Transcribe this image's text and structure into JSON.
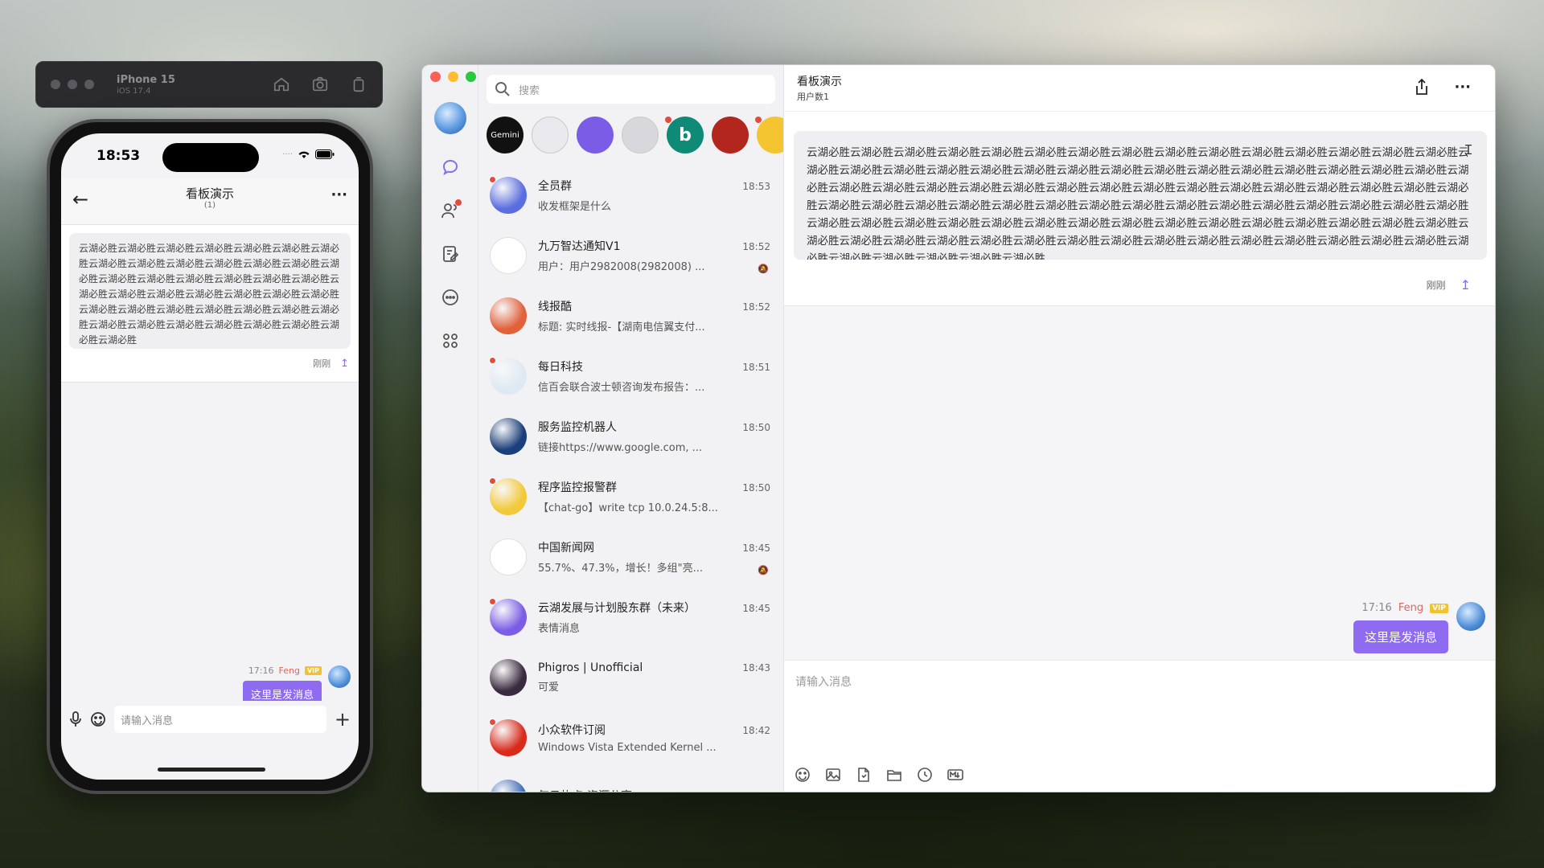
{
  "simulator": {
    "device": "iPhone 15",
    "os": "iOS 17.4",
    "icons": [
      "home-icon",
      "screenshot-icon",
      "rotate-icon"
    ]
  },
  "phone": {
    "time": "18:53",
    "title": "看板演示",
    "subtitle": "(1)",
    "board_text": "云湖必胜云湖必胜云湖必胜云湖必胜云湖必胜云湖必胜云湖必胜云湖必胜云湖必胜云湖必胜云湖必胜云湖必胜云湖必胜云湖必胜云湖必胜云湖必胜云湖必胜云湖必胜云湖必胜云湖必胜云湖必胜云湖必胜云湖必胜云湖必胜云湖必胜云湖必胜云湖必胜云湖必胜云湖必胜云湖必胜云湖必胜云湖必胜云湖必胜云湖必胜云湖必胜云湖必胜云湖必胜云湖必胜云湖必胜云湖必胜云湖必胜云湖必胜",
    "board_time": "刚刚",
    "message": {
      "time": "17:16",
      "sender": "Feng",
      "badge": "VIP",
      "text": "这里是发消息"
    },
    "input_placeholder": "请输入消息"
  },
  "app": {
    "search_placeholder": "搜索",
    "favorites": [
      {
        "label": "Gemini",
        "color": "#111111",
        "dot": false
      },
      {
        "label": "",
        "color": "#e9e9ee",
        "dot": false
      },
      {
        "label": "",
        "color": "#7b5ce6",
        "dot": false
      },
      {
        "label": "",
        "color": "#d7d7dc",
        "dot": false
      },
      {
        "label": "b",
        "color": "#0f8a76",
        "dot": true
      },
      {
        "label": "",
        "color": "#b3261e",
        "dot": false
      },
      {
        "label": "",
        "color": "#f4c531",
        "dot": true
      }
    ],
    "conversations": [
      {
        "name": "全员群",
        "time": "18:53",
        "preview": "收发框架是什么",
        "color": "#5b6ee0",
        "dot": true,
        "muted": false
      },
      {
        "name": "九万智达通知V1",
        "time": "18:52",
        "preview": "用户：用户2982008(2982008) ...",
        "color": "#ffffff",
        "dot": false,
        "muted": true
      },
      {
        "name": "线报酷",
        "time": "18:52",
        "preview": "标题: 实时线报-【湖南电信翼支付...",
        "color": "#e0613a",
        "dot": false,
        "muted": false
      },
      {
        "name": "每日科技",
        "time": "18:51",
        "preview": "信百会联合波士顿咨询发布报告：...",
        "color": "#dfe9f3",
        "dot": true,
        "muted": false
      },
      {
        "name": "服务监控机器人",
        "time": "18:50",
        "preview": "链接https://www.google.com, ...",
        "color": "#1b3f7a",
        "dot": false,
        "muted": false
      },
      {
        "name": "程序监控报警群",
        "time": "18:50",
        "preview": "【chat-go】write tcp 10.0.24.5:8...",
        "color": "#f2c93a",
        "dot": true,
        "muted": false
      },
      {
        "name": "中国新闻网",
        "time": "18:45",
        "preview": "55.7%、47.3%，增长！多组\"亮...",
        "color": "#ffffff",
        "dot": false,
        "muted": true
      },
      {
        "name": "云湖发展与计划股东群（未来）",
        "time": "18:45",
        "preview": "表情消息",
        "color": "#7b5ce6",
        "dot": true,
        "muted": false
      },
      {
        "name": "Phigros | Unofficial",
        "time": "18:43",
        "preview": "可爱",
        "color": "#3a2a3f",
        "dot": false,
        "muted": false
      },
      {
        "name": "小众软件订阅",
        "time": "18:42",
        "preview": "Windows Vista Extended Kernel ...",
        "color": "#d92a1c",
        "dot": true,
        "muted": false
      },
      {
        "name": "每日热点-资源分享",
        "time": "18:38",
        "preview": "",
        "color": "#3f6bb8",
        "dot": false,
        "muted": false
      }
    ],
    "chat": {
      "title": "看板演示",
      "subtitle": "用户数1",
      "board_text": "云湖必胜云湖必胜云湖必胜云湖必胜云湖必胜云湖必胜云湖必胜云湖必胜云湖必胜云湖必胜云湖必胜云湖必胜云湖必胜云湖必胜云湖必胜云湖必胜云湖必胜云湖必胜云湖必胜云湖必胜云湖必胜云湖必胜云湖必胜云湖必胜云湖必胜云湖必胜云湖必胜云湖必胜云湖必胜云湖必胜云湖必胜云湖必胜云湖必胜云湖必胜云湖必胜云湖必胜云湖必胜云湖必胜云湖必胜云湖必胜云湖必胜云湖必胜云湖必胜云湖必胜云湖必胜云湖必胜云湖必胜云湖必胜云湖必胜云湖必胜云湖必胜云湖必胜云湖必胜云湖必胜云湖必胜云湖必胜云湖必胜云湖必胜云湖必胜云湖必胜云湖必胜云湖必胜云湖必胜云湖必胜云湖必胜云湖必胜云湖必胜云湖必胜云湖必胜云湖必胜云湖必胜云湖必胜云湖必胜云湖必胜云湖必胜云湖必胜云湖必胜云湖必胜云湖必胜云湖必胜云湖必胜云湖必胜云湖必胜云湖必胜云湖必胜云湖必胜云湖必胜云湖必胜云湖必胜云湖必胜云湖必胜云湖必胜云湖必胜云湖必胜云湖必胜云湖必胜云湖必胜",
      "board_time": "刚刚",
      "message": {
        "time": "17:16",
        "sender": "Feng",
        "badge": "VIP",
        "text": "这里是发消息"
      },
      "input_placeholder": "请输入消息",
      "tools": [
        "emoji-icon",
        "image-icon",
        "file-icon",
        "folder-icon",
        "clock-icon",
        "markdown-icon"
      ]
    }
  }
}
